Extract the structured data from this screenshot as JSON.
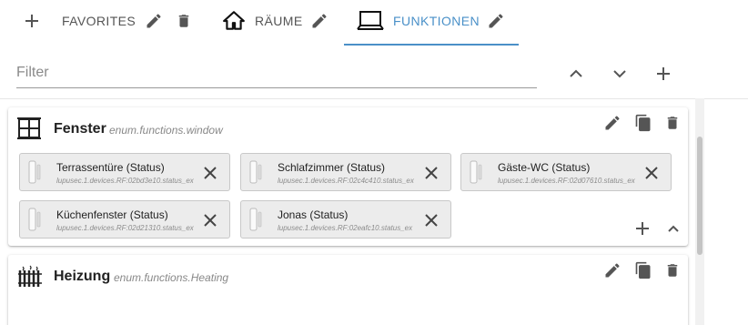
{
  "tabs": [
    {
      "label": "FAVORITES",
      "icon": "plus-icon"
    },
    {
      "label": "RÄUME",
      "icon": "home-icon"
    },
    {
      "label": "FUNKTIONEN",
      "icon": "laptop-icon",
      "active": true
    }
  ],
  "filter": {
    "placeholder": "Filter"
  },
  "colors": {
    "accent": "#4a90c8",
    "icon": "#555555",
    "chip": "#ececec"
  },
  "cards": [
    {
      "title": "Fenster",
      "subtitle": "enum.functions.window",
      "icon": "window-icon",
      "items": [
        {
          "name": "Terrassentüre (Status)",
          "id": "lupusec.1.devices.RF:02bd3e10.status_ex"
        },
        {
          "name": "Schlafzimmer (Status)",
          "id": "lupusec.1.devices.RF:02c4c410.status_ex"
        },
        {
          "name": "Gäste-WC (Status)",
          "id": "lupusec.1.devices.RF:02d07610.status_ex"
        },
        {
          "name": "Küchenfenster (Status)",
          "id": "lupusec.1.devices.RF:02d21310.status_ex"
        },
        {
          "name": "Jonas (Status)",
          "id": "lupusec.1.devices.RF:02eafc10.status_ex"
        }
      ]
    },
    {
      "title": "Heizung",
      "subtitle": "enum.functions.Heating",
      "icon": "radiator-icon",
      "items": []
    }
  ]
}
